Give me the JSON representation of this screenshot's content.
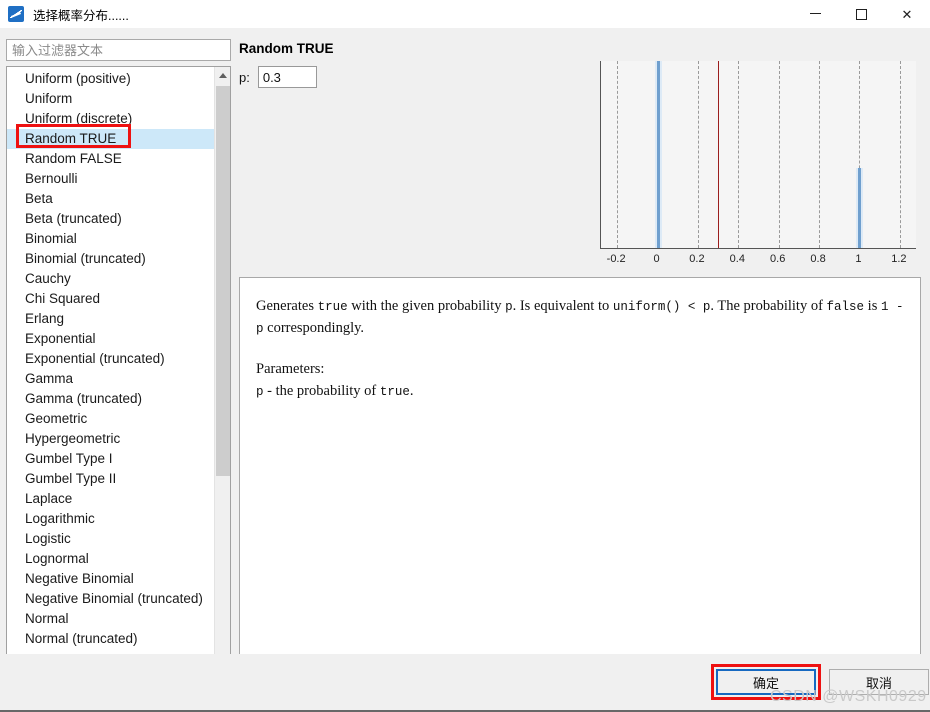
{
  "window": {
    "title": "选择概率分布......",
    "icon": "chart-app-icon",
    "controls": {
      "minimize": "minimize-icon",
      "maximize": "maximize-icon",
      "close": "close-icon"
    }
  },
  "filter": {
    "placeholder": "输入过滤器文本",
    "value": ""
  },
  "distribution_list": {
    "selected": "Random TRUE",
    "items": [
      "Uniform (positive)",
      "Uniform",
      "Uniform (discrete)",
      "Random TRUE",
      "Random FALSE",
      "Bernoulli",
      "Beta",
      "Beta (truncated)",
      "Binomial",
      "Binomial (truncated)",
      "Cauchy",
      "Chi Squared",
      "Erlang",
      "Exponential",
      "Exponential (truncated)",
      "Gamma",
      "Gamma (truncated)",
      "Geometric",
      "Hypergeometric",
      "Gumbel Type I",
      "Gumbel Type II",
      "Laplace",
      "Logarithmic",
      "Logistic",
      "Lognormal",
      "Negative Binomial",
      "Negative Binomial (truncated)",
      "Normal",
      "Normal (truncated)"
    ],
    "scrollbar": {
      "up_arrow": "scroll-up-icon",
      "down_arrow": "scroll-down-icon"
    }
  },
  "detail": {
    "title": "Random TRUE",
    "parameter_label": "p:",
    "parameter_value": "0.3"
  },
  "chart_data": {
    "type": "bar",
    "title": "",
    "xlabel": "",
    "ylabel": "",
    "categories": [
      "0",
      "1"
    ],
    "x": [
      0,
      1
    ],
    "values": [
      0.7,
      0.3
    ],
    "xlim": [
      -0.28,
      1.28
    ],
    "ylim": [
      0,
      0.7
    ],
    "xticks": [
      -0.2,
      0,
      0.2,
      0.4,
      0.6,
      0.8,
      1,
      1.2
    ],
    "xticklabels": [
      "-0.2",
      "0",
      "0.2",
      "0.4",
      "0.6",
      "0.8",
      "1",
      "1.2"
    ],
    "grid": true,
    "grid_style": "dashed-vertical",
    "legend": "none",
    "annotations": [
      {
        "type": "vline",
        "name": "p-marker",
        "value": 0.3,
        "color": "#9b1d1d"
      }
    ],
    "bar_color": "#6f9fce",
    "bar_halo_color": "#ddeaf6",
    "plot_background": "#f5f5f5"
  },
  "description": {
    "paragraph1_parts": [
      {
        "text": "Generates ",
        "style": "serif"
      },
      {
        "text": "true",
        "style": "mono"
      },
      {
        "text": " with the given probability ",
        "style": "serif"
      },
      {
        "text": "p",
        "style": "mono"
      },
      {
        "text": ". Is equivalent to ",
        "style": "serif"
      },
      {
        "text": "uniform() < p",
        "style": "mono"
      },
      {
        "text": ". The probability of ",
        "style": "serif"
      },
      {
        "text": "false",
        "style": "mono"
      },
      {
        "text": " is ",
        "style": "serif"
      },
      {
        "text": "1 - p",
        "style": "mono"
      },
      {
        "text": " correspondingly.",
        "style": "serif"
      }
    ],
    "p1_seg1": "Generates ",
    "p1_code1": "true",
    "p1_seg2": " with the given probability ",
    "p1_code2": "p",
    "p1_seg3": ". Is equivalent to ",
    "p1_code3": "uniform() < p",
    "p1_seg4": ". The probability of ",
    "p1_code4": "false",
    "p1_seg5": " is ",
    "p1_code5": "1 - p",
    "p1_seg6": " correspondingly.",
    "params_title": "Parameters:",
    "param_code": "p",
    "param_desc_pre": " - the probability of ",
    "param_code2": "true",
    "param_desc_post": "."
  },
  "buttons": {
    "ok": "确定",
    "cancel": "取消"
  },
  "watermark": "CSDN @WSKH0929",
  "colors": {
    "selection": "#cde8f9",
    "annotation": "#ee1111",
    "focus": "#1669c1",
    "bar": "#6f9fce",
    "marker_line": "#9b1d1d"
  }
}
